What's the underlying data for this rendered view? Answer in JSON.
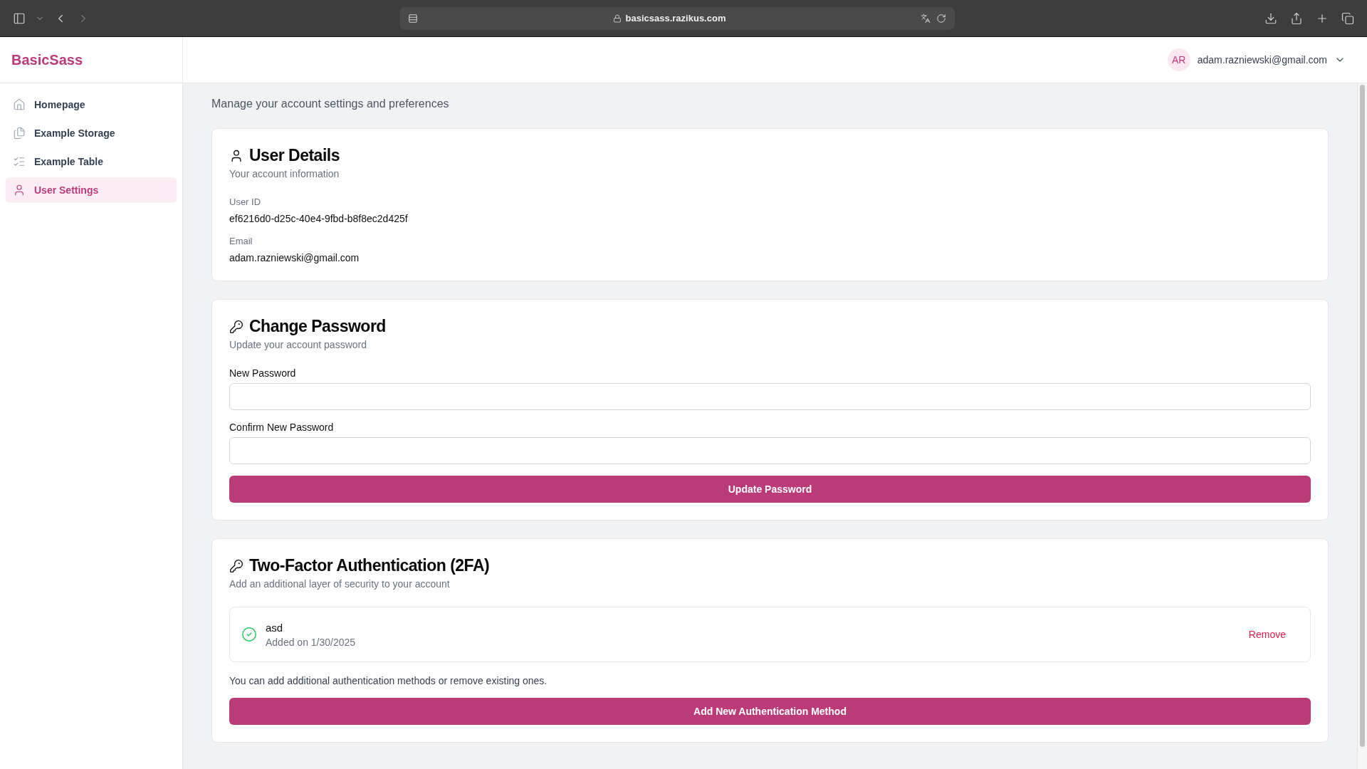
{
  "browser": {
    "url": "basicsass.razikus.com"
  },
  "sidebar": {
    "brand": "BasicSass",
    "items": [
      {
        "label": "Homepage",
        "selected": false
      },
      {
        "label": "Example Storage",
        "selected": false
      },
      {
        "label": "Example Table",
        "selected": false
      },
      {
        "label": "User Settings",
        "selected": true
      }
    ]
  },
  "header": {
    "avatar_initials": "AR",
    "email": "adam.razniewski@gmail.com"
  },
  "page": {
    "subtitle": "Manage your account settings and preferences"
  },
  "user_details": {
    "title": "User Details",
    "subtitle": "Your account information",
    "fields": [
      {
        "label": "User ID",
        "value": "ef6216d0-d25c-40e4-9fbd-b8f8ec2d425f"
      },
      {
        "label": "Email",
        "value": "adam.razniewski@gmail.com"
      }
    ]
  },
  "change_password": {
    "title": "Change Password",
    "subtitle": "Update your account password",
    "fields": [
      {
        "label": "New Password"
      },
      {
        "label": "Confirm New Password"
      }
    ],
    "button": "Update Password"
  },
  "two_factor": {
    "title": "Two-Factor Authentication (2FA)",
    "subtitle": "Add an additional layer of security to your account",
    "methods": [
      {
        "name": "asd",
        "added": "Added on 1/30/2025",
        "action": "Remove"
      }
    ],
    "note": "You can add additional authentication methods or remove existing ones.",
    "button": "Add New Authentication Method"
  }
}
